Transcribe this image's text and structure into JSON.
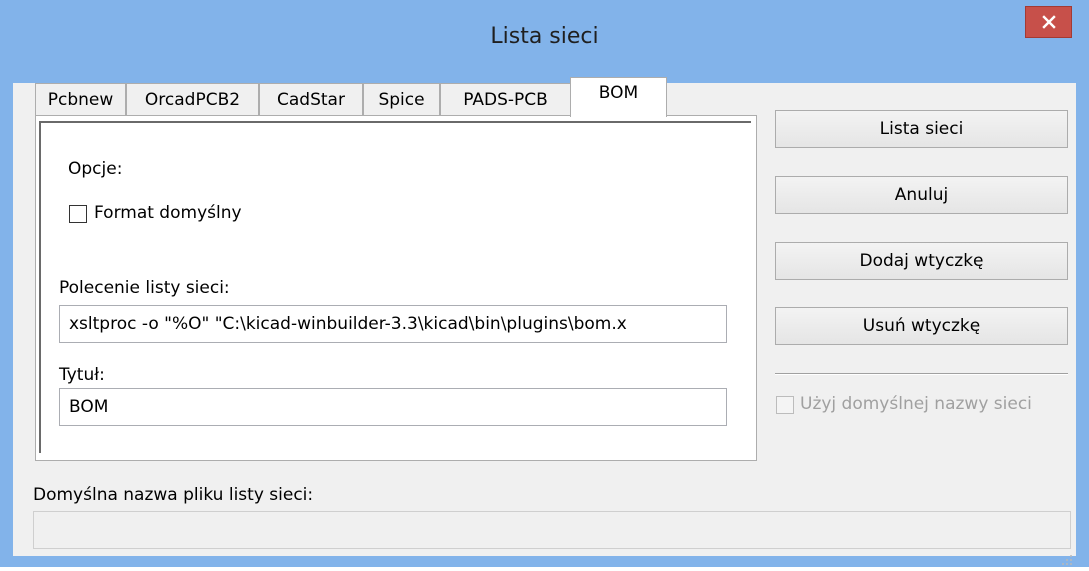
{
  "window": {
    "title": "Lista sieci",
    "accent_color": "#82b3ea",
    "close_color": "#c7504a",
    "close_icon": "close-icon"
  },
  "tabs": [
    {
      "label": "Pcbnew",
      "active": false
    },
    {
      "label": "OrcadPCB2",
      "active": false
    },
    {
      "label": "CadStar",
      "active": false
    },
    {
      "label": "Spice",
      "active": false
    },
    {
      "label": "PADS-PCB",
      "active": false
    },
    {
      "label": "BOM",
      "active": true
    }
  ],
  "bom_panel": {
    "options_label": "Opcje:",
    "default_format_label": "Format domyślny",
    "default_format_checked": false,
    "command_label": "Polecenie listy sieci:",
    "command_value": "xsltproc -o \"%O\" \"C:\\kicad-winbuilder-3.3\\kicad\\bin\\plugins\\bom.x",
    "title_label": "Tytuł:",
    "title_value": "BOM"
  },
  "buttons": {
    "netlist": "Lista sieci",
    "cancel": "Anuluj",
    "add_plugin": "Dodaj wtyczkę",
    "remove_plugin": "Usuń wtyczkę"
  },
  "use_default_name": {
    "label": "Użyj domyślnej nazwy sieci",
    "checked": false,
    "enabled": false
  },
  "default_filename": {
    "label": "Domyślna nazwa pliku listy sieci:",
    "value": ""
  }
}
